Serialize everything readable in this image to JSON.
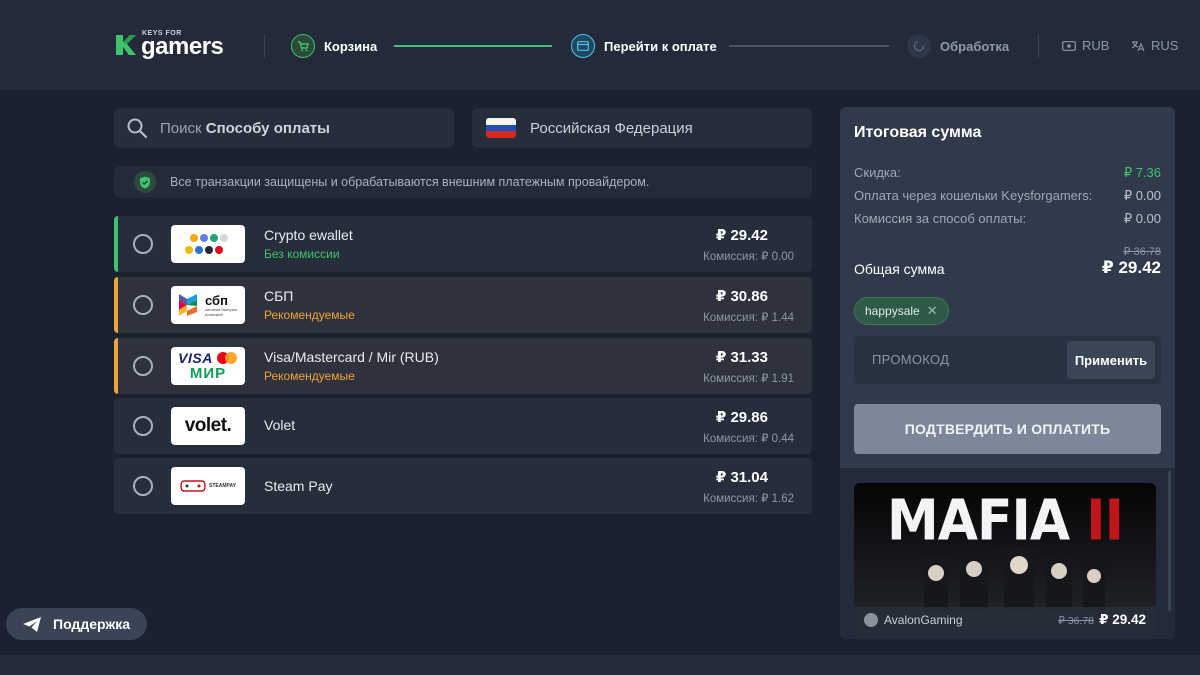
{
  "header": {
    "logo_small": "KEYS FOR",
    "logo_main": "gamers",
    "steps": [
      {
        "label": "Корзина",
        "state": "done"
      },
      {
        "label": "Перейти к оплате",
        "state": "active"
      },
      {
        "label": "Обработка",
        "state": "pending"
      }
    ],
    "currency": "RUB",
    "language": "RUS"
  },
  "search": {
    "prefix": "Поиск",
    "bold": "Способу оплаты"
  },
  "country": "Российская Федерация",
  "notice": "Все транзакции защищены и обрабатываются внешним платежным провайдером.",
  "payment_methods": [
    {
      "name": "Crypto ewallet",
      "tag": "Без комиссии",
      "tag_color": "green",
      "price": "₽ 29.42",
      "fee": "Комиссия: ₽ 0.00",
      "logo": "crypto-logo",
      "accent": "#3ec46d",
      "selected": false
    },
    {
      "name": "СБП",
      "tag": "Рекомендуемые",
      "tag_color": "orange",
      "price": "₽ 30.86",
      "fee": "Комиссия: ₽ 1.44",
      "logo": "sbp-logo",
      "logo_text": "сбп",
      "logo_sub": "система быстрых платежей",
      "accent": "#f2a23a",
      "selected": false
    },
    {
      "name": "Visa/Mastercard / Mir (RUB)",
      "tag": "Рекомендуемые",
      "tag_color": "orange",
      "price": "₽ 31.33",
      "fee": "Комиссия: ₽ 1.91",
      "logo": "visa-mir-logo",
      "logo_text_1": "VISA",
      "logo_text_2": "МИР",
      "accent": "#f2a23a",
      "selected": false
    },
    {
      "name": "Volet",
      "tag": "",
      "tag_color": "",
      "price": "₽ 29.86",
      "fee": "Комиссия: ₽ 0.44",
      "logo": "volet-logo",
      "logo_text": "volet.",
      "accent": "",
      "selected": false
    },
    {
      "name": "Steam Pay",
      "tag": "",
      "tag_color": "",
      "price": "₽ 31.04",
      "fee": "Комиссия: ₽ 1.62",
      "logo": "steampay-logo",
      "logo_text": "STEAMPAY",
      "accent": "",
      "selected": false
    }
  ],
  "summary": {
    "title": "Итоговая сумма",
    "lines": [
      {
        "label": "Скидка:",
        "value": "₽ 7.36",
        "color": "green"
      },
      {
        "label": "Оплата через кошельки Keysforgamers:",
        "value": "₽ 0.00",
        "color": ""
      },
      {
        "label": "Комиссия за способ оплаты:",
        "value": "₽ 0.00",
        "color": ""
      }
    ],
    "total_old": "₽ 36.78",
    "total_label": "Общая сумма",
    "total": "₽ 29.42",
    "promo_tag": "happysale",
    "promo_placeholder": "ПРОМОКОД",
    "apply_label": "Применить",
    "confirm_label": "ПОДТВЕРДИТЬ И ОПЛАТИТЬ"
  },
  "game": {
    "title": "MAFIA",
    "numeral": "II",
    "seller": "AvalonGaming",
    "old_price": "₽ 36.78",
    "price": "₽ 29.42"
  },
  "support_label": "Поддержка",
  "colors": {
    "accent_green": "#3ec46d",
    "accent_orange": "#f2a23a",
    "step_active": "#4fc3f7"
  }
}
